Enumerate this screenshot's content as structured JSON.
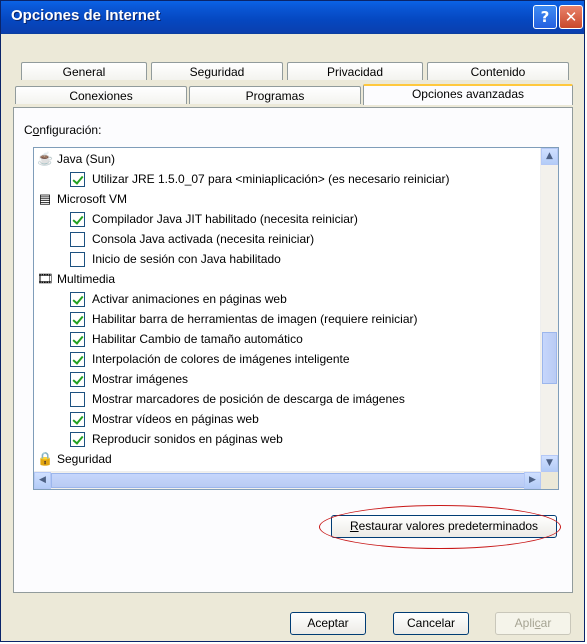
{
  "window": {
    "title": "Opciones de Internet",
    "help_label": "?",
    "close_label": "✕"
  },
  "tabs": {
    "row1": [
      "General",
      "Seguridad",
      "Privacidad",
      "Contenido"
    ],
    "row2": [
      "Conexiones",
      "Programas",
      "Opciones avanzadas"
    ],
    "active": "Opciones avanzadas"
  },
  "settings": {
    "label_first": "C",
    "label_underlined": "o",
    "label_rest": "nfiguración:",
    "items": [
      {
        "kind": "group",
        "label": "Java (Sun)",
        "icon": "java-cup-icon"
      },
      {
        "kind": "check",
        "label": "Utilizar JRE 1.5.0_07 para <miniaplicación> (es necesario reiniciar)",
        "checked": true
      },
      {
        "kind": "group",
        "label": "Microsoft VM",
        "icon": "document-icon"
      },
      {
        "kind": "check",
        "label": "Compilador Java JIT habilitado (necesita reiniciar)",
        "checked": true
      },
      {
        "kind": "check",
        "label": "Consola Java activada (necesita reiniciar)",
        "checked": false
      },
      {
        "kind": "check",
        "label": "Inicio de sesión con Java habilitado",
        "checked": false
      },
      {
        "kind": "group",
        "label": "Multimedia",
        "icon": "multimedia-icon"
      },
      {
        "kind": "check",
        "label": "Activar animaciones en páginas web",
        "checked": true
      },
      {
        "kind": "check",
        "label": "Habilitar barra de herramientas de imagen (requiere reiniciar)",
        "checked": true
      },
      {
        "kind": "check",
        "label": "Habilitar Cambio de tamaño automático",
        "checked": true
      },
      {
        "kind": "check",
        "label": "Interpolación de colores de imágenes inteligente",
        "checked": true
      },
      {
        "kind": "check",
        "label": "Mostrar imágenes",
        "checked": true
      },
      {
        "kind": "check",
        "label": "Mostrar marcadores de posición de descarga de imágenes",
        "checked": false
      },
      {
        "kind": "check",
        "label": "Mostrar vídeos en páginas web",
        "checked": true
      },
      {
        "kind": "check",
        "label": "Reproducir sonidos en páginas web",
        "checked": true
      },
      {
        "kind": "group",
        "label": "Seguridad",
        "icon": "lock-icon"
      }
    ]
  },
  "buttons": {
    "restore_first": "R",
    "restore_rest": "estaurar valores predeterminados",
    "ok": "Aceptar",
    "cancel": "Cancelar",
    "apply_pre": "Apli",
    "apply_underlined": "c",
    "apply_post": "ar"
  },
  "colors": {
    "titlebar": "#0a57d6",
    "annotation_ring": "#c81818",
    "checkmark": "#21a121"
  }
}
